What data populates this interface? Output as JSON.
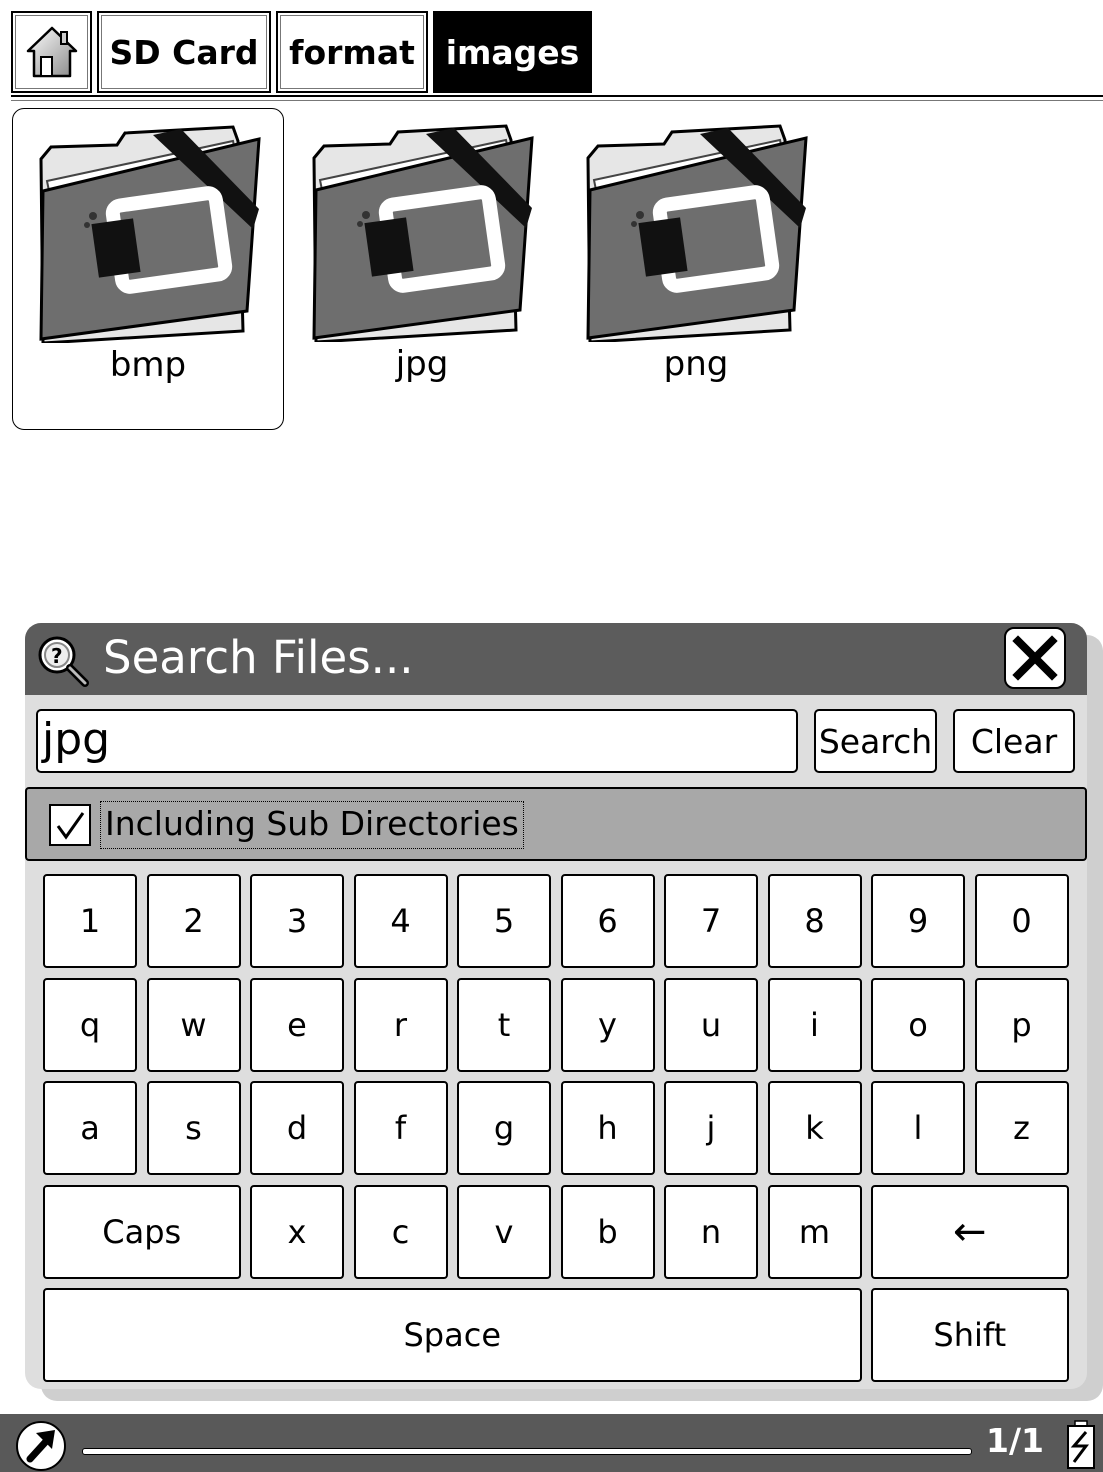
{
  "breadcrumb": {
    "home_icon": "home-icon",
    "items": [
      "SD Card",
      "format",
      "images"
    ],
    "active_index": 2
  },
  "folders": [
    {
      "name": "bmp",
      "icon": "image-folder-icon",
      "selected": true
    },
    {
      "name": "jpg",
      "icon": "image-folder-icon",
      "selected": false
    },
    {
      "name": "png",
      "icon": "image-folder-icon",
      "selected": false
    }
  ],
  "search_dialog": {
    "title": "Search Files...",
    "title_icon": "magnifier-help-icon",
    "close_icon": "close-icon",
    "query": "jpg",
    "search_label": "Search",
    "clear_label": "Clear",
    "include_subdirs": {
      "label": "Including Sub Directories",
      "checked": true
    }
  },
  "keyboard": {
    "rows": [
      [
        "1",
        "2",
        "3",
        "4",
        "5",
        "6",
        "7",
        "8",
        "9",
        "0"
      ],
      [
        "q",
        "w",
        "e",
        "r",
        "t",
        "y",
        "u",
        "i",
        "o",
        "p"
      ],
      [
        "a",
        "s",
        "d",
        "f",
        "g",
        "h",
        "j",
        "k",
        "l",
        "z"
      ],
      [
        "Caps",
        "x",
        "c",
        "v",
        "b",
        "n",
        "m",
        "←"
      ],
      [
        "Space",
        "Shift"
      ]
    ]
  },
  "status_bar": {
    "rotate_icon": "rotate-arrow-icon",
    "page": "1/1",
    "battery_icon": "battery-charging-icon",
    "progress": 1.0
  },
  "colors": {
    "title_bar": "#5c5c5c",
    "dialog_bg": "#dedede",
    "subdir_bar": "#a8a8a8",
    "active_crumb": "#000000",
    "status_bar": "#595959"
  }
}
